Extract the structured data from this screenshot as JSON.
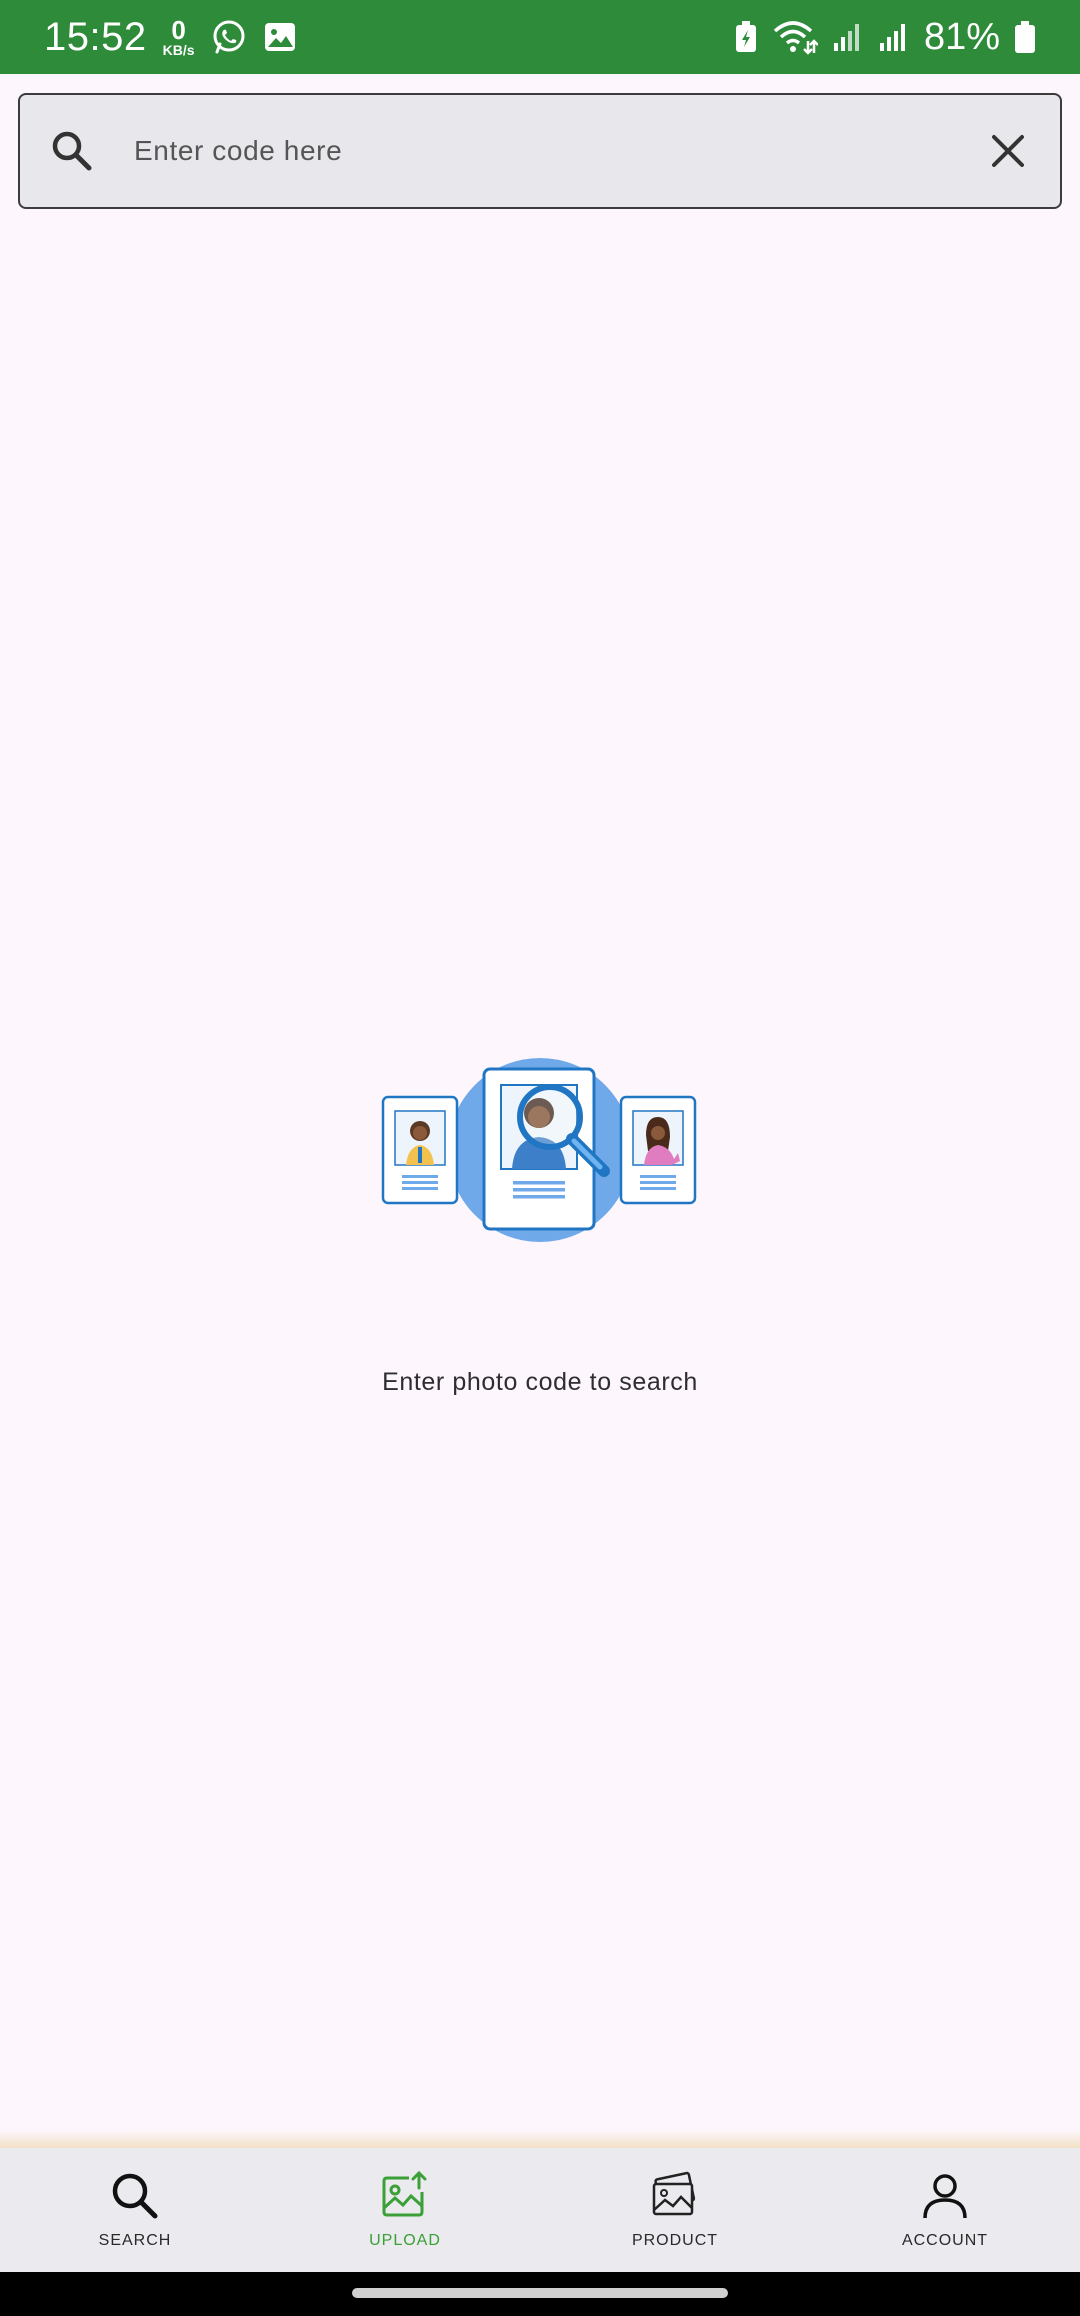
{
  "status_bar": {
    "time": "15:52",
    "net_speed_value": "0",
    "net_speed_unit": "KB/s",
    "battery_percent": "81%",
    "icons": [
      "whatsapp-icon",
      "gallery-icon",
      "battery-saver-icon",
      "wifi-icon",
      "signal-icon",
      "signal-icon",
      "battery-icon"
    ]
  },
  "search": {
    "placeholder": "Enter code here",
    "value": "",
    "icon": "search-icon",
    "clear_icon": "close-icon"
  },
  "empty_state": {
    "illustration": "id-cards-search-illustration",
    "message": "Enter photo code to search"
  },
  "bottom_nav": {
    "active": "UPLOAD",
    "active_color": "#3aa037",
    "items": [
      {
        "label": "SEARCH",
        "icon": "search-icon"
      },
      {
        "label": "UPLOAD",
        "icon": "image-upload-icon"
      },
      {
        "label": "PRODUCT",
        "icon": "photos-icon"
      },
      {
        "label": "ACCOUNT",
        "icon": "person-icon"
      }
    ]
  },
  "colors": {
    "status_bar": "#2e8b3a",
    "background": "#fdf7fd",
    "nav_background": "#ebeaee",
    "illustration_blue": "#2176c4"
  }
}
